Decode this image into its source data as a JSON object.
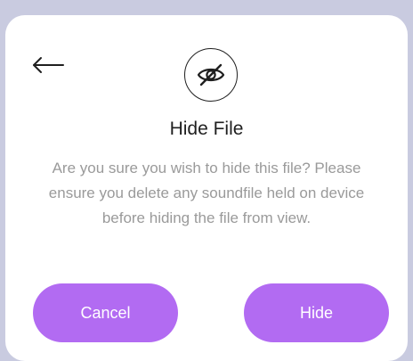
{
  "dialog": {
    "title": "Hide File",
    "message": "Are you sure you wish to hide this file? Please ensure you delete any soundfile held on device before hiding the file from view.",
    "cancel_label": "Cancel",
    "confirm_label": "Hide"
  },
  "icons": {
    "back": "arrow-left-icon",
    "header": "eye-off-icon"
  },
  "colors": {
    "accent": "#b26bf2",
    "backdrop": "#c9cbe0",
    "message_text": "#9a9a9a"
  }
}
